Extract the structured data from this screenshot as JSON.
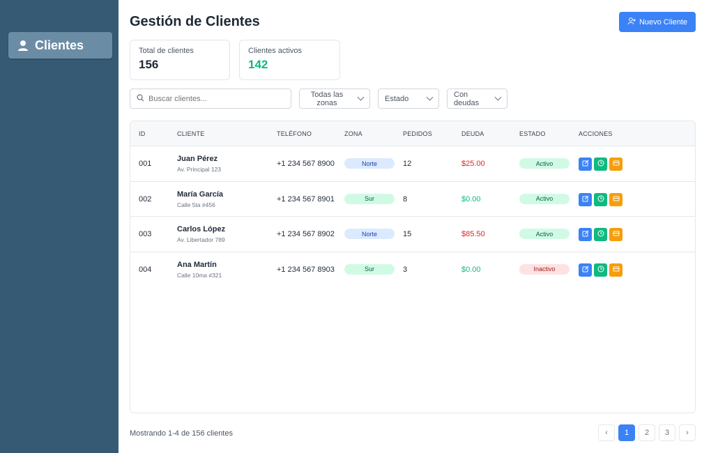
{
  "sidebar": {
    "item_label": "Clientes",
    "icon": "user-icon"
  },
  "header": {
    "title": "Gestión de Clientes",
    "new_button": "Nuevo Cliente"
  },
  "stats": [
    {
      "label": "Total de clientes",
      "value": "156"
    },
    {
      "label": "Clientes activos",
      "value": "142"
    }
  ],
  "filters": {
    "search_placeholder": "Buscar clientes...",
    "zones": "Todas las zonas",
    "status": "Estado",
    "debts": "Con deudas"
  },
  "table": {
    "headers": [
      "ID",
      "CLIENTE",
      "TELÉFONO",
      "ZONA",
      "PEDIDOS",
      "DEUDA",
      "ESTADO",
      "ACCIONES"
    ],
    "rows": [
      {
        "id": "001",
        "name": "Juan Pérez",
        "address": "Av. Principal 123",
        "phone": "+1 234 567 8900",
        "zone": "Norte",
        "orders": "12",
        "debt": "$25.00",
        "status": "Activo"
      },
      {
        "id": "002",
        "name": "María García",
        "address": "Calle 5ta #456",
        "phone": "+1 234 567 8901",
        "zone": "Sur",
        "orders": "8",
        "debt": "$0.00",
        "status": "Activo"
      },
      {
        "id": "003",
        "name": "Carlos López",
        "address": "Av. Libertador 789",
        "phone": "+1 234 567 8902",
        "zone": "Norte",
        "orders": "15",
        "debt": "$85.50",
        "status": "Activo"
      },
      {
        "id": "004",
        "name": "Ana Martín",
        "address": "Calle 10ma #321",
        "phone": "+1 234 567 8903",
        "zone": "Sur",
        "orders": "3",
        "debt": "$0.00",
        "status": "Inactivo"
      }
    ]
  },
  "footer": {
    "showing": "Mostrando 1-4 de 156 clientes"
  },
  "pagination": {
    "prev": "‹",
    "pages": [
      "1",
      "2",
      "3"
    ],
    "next": "›",
    "current": "1"
  },
  "colors": {
    "sidebar": "#365a74",
    "accent": "#3b82f6",
    "success": "#10b981",
    "danger": "#dc2626",
    "warning": "#f59e0b"
  }
}
